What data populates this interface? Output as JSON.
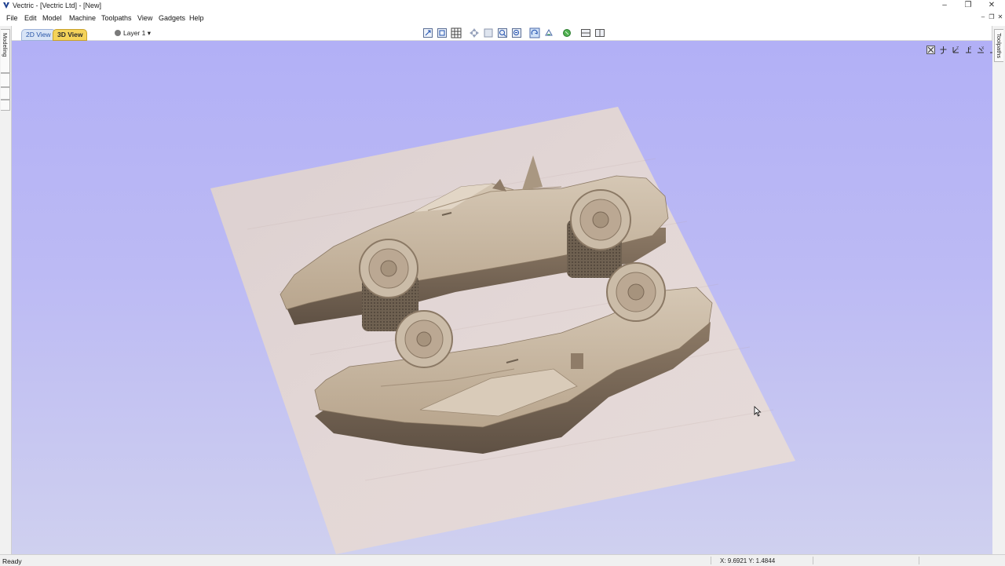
{
  "window": {
    "title": "Vectric - [Vectric Ltd] - [New]",
    "controls": [
      "minimize-icon",
      "restore-icon",
      "close-icon"
    ]
  },
  "menu": [
    "File",
    "Edit",
    "Model",
    "Machine",
    "Toolpaths",
    "View",
    "Gadgets",
    "Help"
  ],
  "tabs": {
    "view2d": "2D View",
    "view3d": "3D View"
  },
  "layer": {
    "label": "Layer 1",
    "dropdown_glyph": "▾"
  },
  "side_tabs": {
    "left": "Modeling",
    "right": "Toolpaths"
  },
  "status": {
    "ready": "Ready",
    "coords": "X: 9.6921 Y: 1.4844"
  },
  "colors": {
    "viewport_top": "#b2b0f6",
    "viewport_bottom": "#cfd0ef",
    "wood": "#c7b6a0",
    "tab_active": "#f4d35a"
  }
}
